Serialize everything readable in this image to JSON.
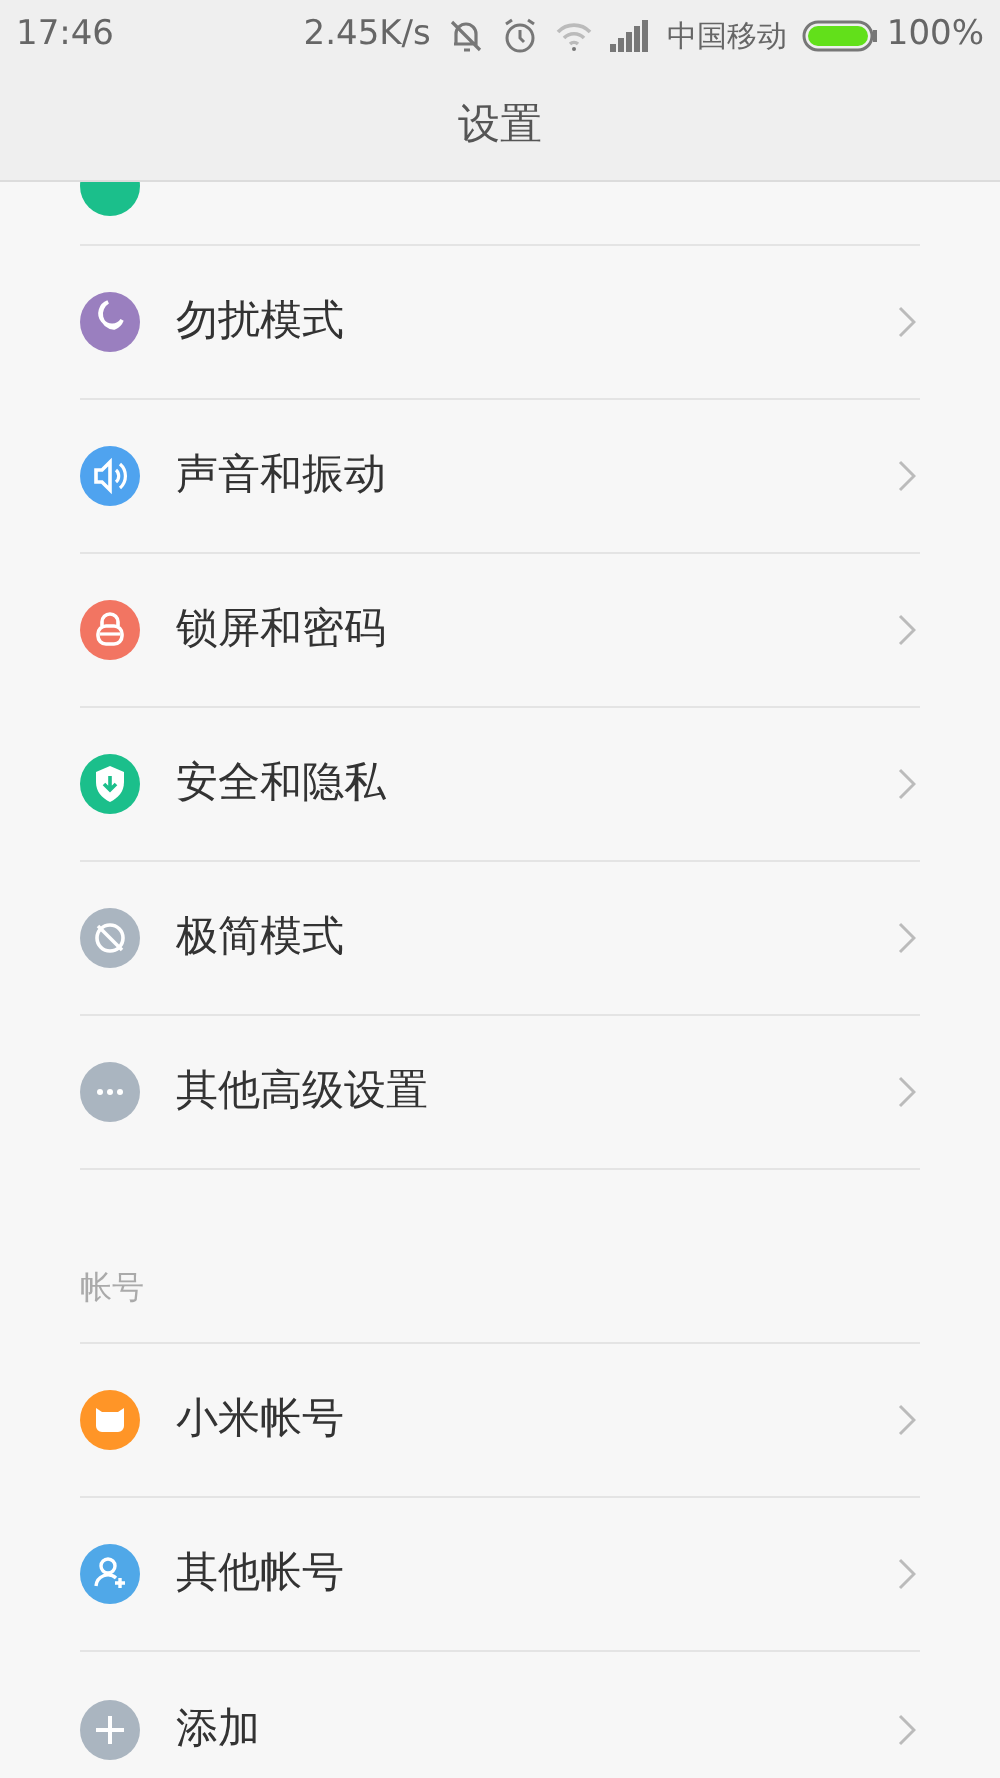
{
  "status_bar": {
    "time": "17:46",
    "speed": "2.45K/s",
    "carrier": "中国移动",
    "battery": "100%"
  },
  "header": {
    "title": "设置"
  },
  "top_row": {
    "color": "#1bbf8b"
  },
  "items": [
    {
      "label": "勿扰模式",
      "kind": "moon",
      "color": "#9a7fbf"
    },
    {
      "label": "声音和振动",
      "kind": "speaker",
      "color": "#4fa3ef"
    },
    {
      "label": "锁屏和密码",
      "kind": "lock",
      "color": "#f27562"
    },
    {
      "label": "安全和隐私",
      "kind": "shield",
      "color": "#1bbf8b"
    },
    {
      "label": "极简模式",
      "kind": "minimal",
      "color": "#aab5c0"
    },
    {
      "label": "其他高级设置",
      "kind": "more",
      "color": "#aab5c0"
    }
  ],
  "account_section": {
    "title": "帐号",
    "items": [
      {
        "label": "小米帐号",
        "kind": "mi",
        "color": "#ff9527"
      },
      {
        "label": "其他帐号",
        "kind": "user-add",
        "color": "#50a8e8"
      },
      {
        "label": "添加",
        "kind": "plus",
        "color": "#aab5c0"
      }
    ]
  }
}
